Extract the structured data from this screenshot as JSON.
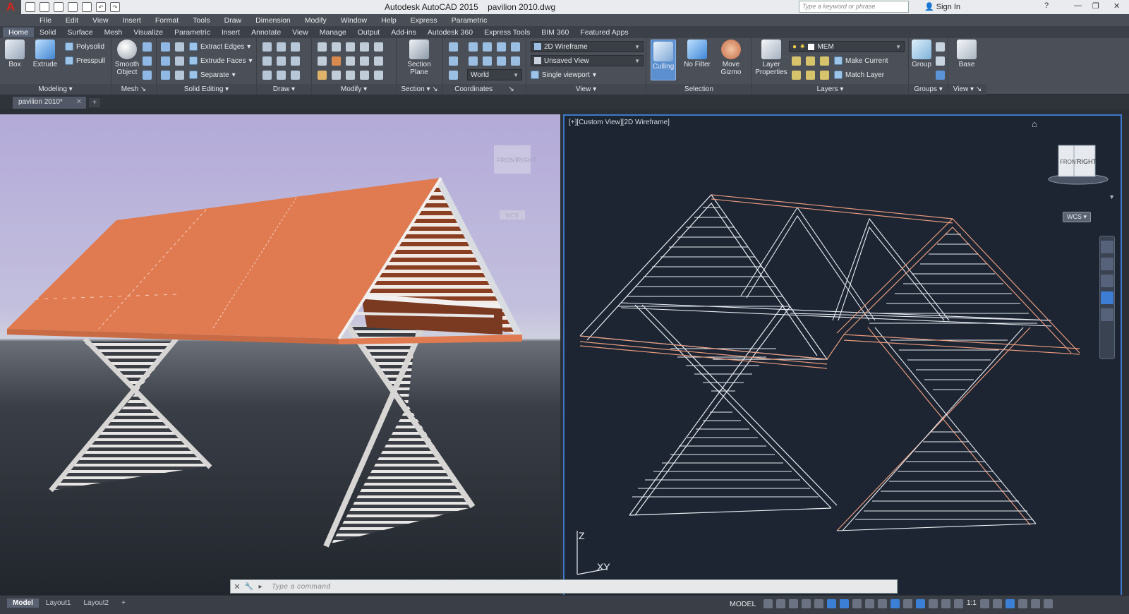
{
  "app": {
    "title": "Autodesk AutoCAD 2015",
    "filename": "pavilion 2010.dwg",
    "search_placeholder": "Type a keyword or phrase",
    "sign_in": "Sign In"
  },
  "menu": [
    "File",
    "Edit",
    "View",
    "Insert",
    "Format",
    "Tools",
    "Draw",
    "Dimension",
    "Modify",
    "Window",
    "Help",
    "Express",
    "Parametric"
  ],
  "ribbon_tabs": [
    "Home",
    "Solid",
    "Surface",
    "Mesh",
    "Visualize",
    "Parametric",
    "Insert",
    "Annotate",
    "View",
    "Manage",
    "Output",
    "Add-ins",
    "Autodesk 360",
    "Express Tools",
    "BIM 360",
    "Featured Apps"
  ],
  "ribbon": {
    "modeling": {
      "title": "Modeling",
      "box": "Box",
      "extrude": "Extrude",
      "polysolid": "Polysolid",
      "presspull": "Presspull"
    },
    "mesh": {
      "title": "Mesh",
      "smooth_object_line1": "Smooth",
      "smooth_object_line2": "Object"
    },
    "solid_editing": {
      "title": "Solid Editing",
      "extract_edges": "Extract Edges",
      "extrude_faces": "Extrude Faces",
      "separate": "Separate"
    },
    "draw": {
      "title": "Draw"
    },
    "modify": {
      "title": "Modify"
    },
    "section": {
      "title": "Section",
      "section_plane_line1": "Section",
      "section_plane_line2": "Plane"
    },
    "coordinates": {
      "title": "Coordinates",
      "world": "World"
    },
    "view": {
      "title": "View",
      "visual_style": "2D Wireframe",
      "named_view": "Unsaved View",
      "viewport": "Single viewport"
    },
    "selection": {
      "title": "Selection",
      "culling": "Culling",
      "no_filter": "No Filter",
      "move_gizmo_line1": "Move",
      "move_gizmo_line2": "Gizmo"
    },
    "layers": {
      "title": "Layers",
      "layer_properties_line1": "Layer",
      "layer_properties_line2": "Properties",
      "current_layer": "MEM",
      "make_current": "Make Current",
      "match_layer": "Match Layer"
    },
    "groups": {
      "title": "Groups",
      "group": "Group"
    },
    "view2": {
      "title": "View",
      "base": "Base"
    }
  },
  "document_tab": "pavilion 2010*",
  "viewport_right": {
    "label": "[+][Custom View][2D Wireframe]",
    "wcs": "WCS",
    "cube_front": "FRONT",
    "cube_right": "RIGHT",
    "ucs_z": "Z",
    "ucs_xy": "XY"
  },
  "viewport_left": {
    "wcs": "WCS",
    "cube_front": "FRONT",
    "cube_right": "RIGHT"
  },
  "command_line": {
    "placeholder": "Type a command"
  },
  "status": {
    "layout_tabs": [
      "Model",
      "Layout1",
      "Layout2"
    ],
    "active_tab": "Model",
    "model_label": "MODEL",
    "scale": "1:1"
  },
  "colors": {
    "roof": "#e07a50",
    "wire_white": "#e9edf2",
    "wire_orange": "#e89a7c",
    "accent_blue": "#3d7dd3"
  }
}
